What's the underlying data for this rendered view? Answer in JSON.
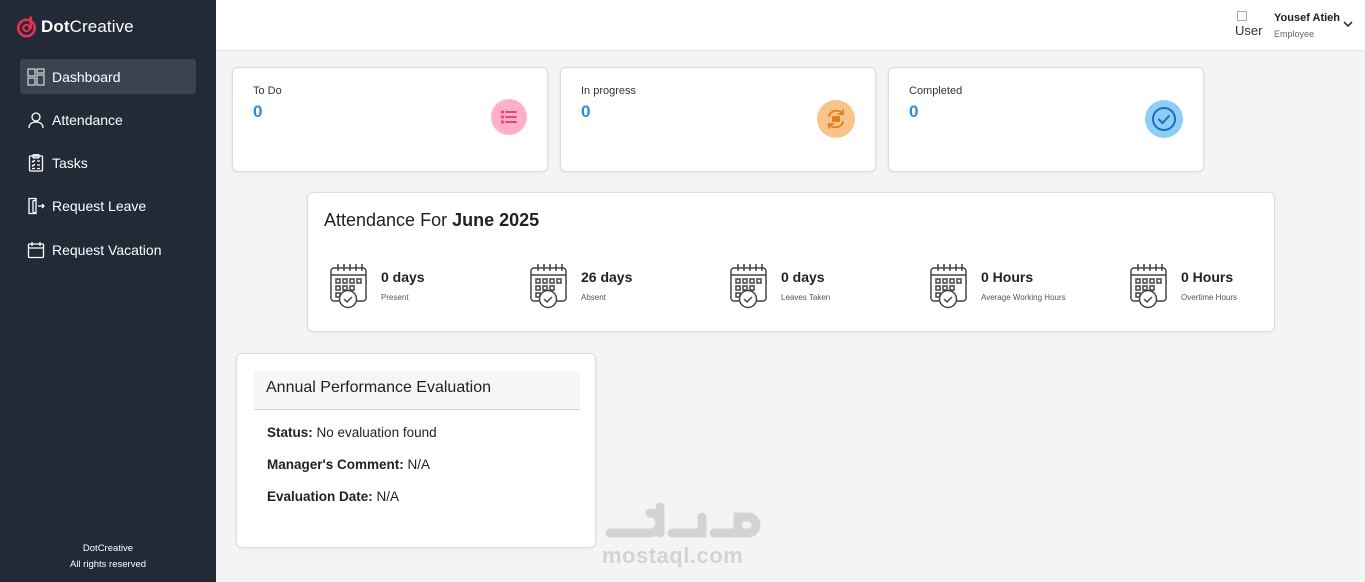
{
  "brand": {
    "name_bold": "Dot",
    "name_rest": "Creative"
  },
  "sidebar": {
    "items": [
      {
        "label": "Dashboard",
        "icon": "dashboard-icon",
        "active": true
      },
      {
        "label": "Attendance",
        "icon": "user-icon"
      },
      {
        "label": "Tasks",
        "icon": "clipboard-icon"
      },
      {
        "label": "Request Leave",
        "icon": "exit-door-icon"
      },
      {
        "label": "Request Vacation",
        "icon": "calendar-icon"
      }
    ],
    "footer_line1": "DotCreative",
    "footer_line2": "All rights reserved"
  },
  "header": {
    "user_img_alt": "User",
    "user_name": "Yousef Atieh",
    "user_role": "Employee"
  },
  "stats": [
    {
      "title": "To Do",
      "value": "0",
      "icon": "list-icon",
      "color": "#ffb0c8",
      "icon_color": "#e8457a"
    },
    {
      "title": "In progress",
      "value": "0",
      "icon": "progress-icon",
      "color": "#f7c58a",
      "icon_color": "#e07c1a"
    },
    {
      "title": "Completed",
      "value": "0",
      "icon": "check-circle-icon",
      "color": "#8ecdf6",
      "icon_color": "#1a6fb8"
    }
  ],
  "attendance": {
    "title_prefix": "Attendance For ",
    "title_period": "June 2025",
    "items": [
      {
        "value": "0 days",
        "label": "Present"
      },
      {
        "value": "26 days",
        "label": "Absent"
      },
      {
        "value": "0 days",
        "label": "Leaves Taken"
      },
      {
        "value": "0 Hours",
        "label": "Average Working Hours"
      },
      {
        "value": "0 Hours",
        "label": "Overtime Hours"
      }
    ]
  },
  "evaluation": {
    "title": "Annual Performance Evaluation",
    "status_label": "Status:",
    "status_value": " No evaluation found",
    "comment_label": "Manager's Comment:",
    "comment_value": " N/A",
    "date_label": "Evaluation Date:",
    "date_value": " N/A"
  },
  "watermark": {
    "text": "mostaql.com"
  },
  "colors": {
    "sidebar_bg": "#222a37",
    "accent_blue": "#2a8cd6",
    "brand_red": "#e8304f"
  }
}
